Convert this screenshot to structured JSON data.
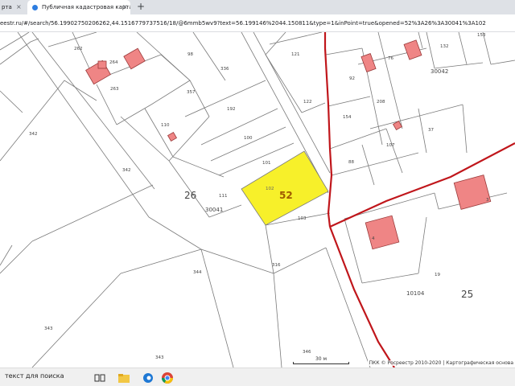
{
  "browser": {
    "tabs": [
      {
        "title": "рта",
        "active": false
      },
      {
        "title": "Публичная кадастровая карта",
        "active": true
      }
    ],
    "new_tab_glyph": "+",
    "close_glyph": "×",
    "url": "eestr.ru/#/search/56.19902750206262,44.1516779737516/18/@6mmb5wv9?text=56.199146%2044.150811&type=1&inPoint=true&opened=52%3A26%3A30041%3A102"
  },
  "map": {
    "quarter_labels": [
      "30041",
      "30042",
      "10104"
    ],
    "district_labels": [
      "26",
      "25"
    ],
    "highlighted_parcel": {
      "label": "52",
      "sublabel": "102",
      "fill": "#f7f02a"
    },
    "parcel_labels": [
      "262",
      "264",
      "263",
      "98",
      "336",
      "357",
      "110",
      "192",
      "342",
      "342",
      "100",
      "101",
      "111",
      "121",
      "122",
      "92",
      "76",
      "132",
      "153",
      "154",
      "208",
      "107",
      "88",
      "37",
      "103",
      "3",
      "4",
      "19",
      "344",
      "316",
      "343",
      "343",
      "346"
    ],
    "colors": {
      "boundary": "#c0161b",
      "parcel_line": "#7a7a7a",
      "building": "#ef8585",
      "label": "#444444",
      "district_label": "#a05a00"
    },
    "scale_label": "30 м",
    "attribution": "ПКК © Росреестр 2010-2020 | Картографическая основа"
  },
  "taskbar": {
    "search_text": "текст для поиска",
    "apps": [
      "task-view-icon",
      "file-explorer-icon",
      "edge-icon",
      "chrome-icon"
    ]
  }
}
